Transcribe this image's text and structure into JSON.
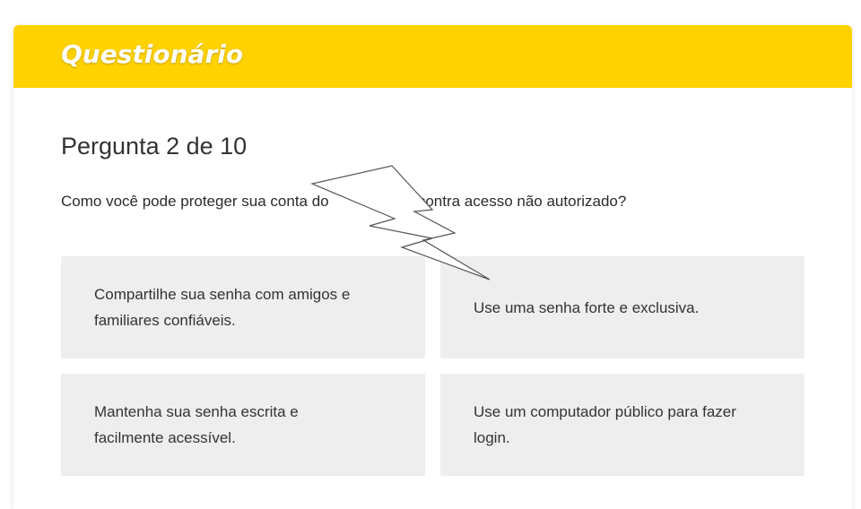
{
  "header": {
    "title": "Questionário",
    "background_color": "#ffd200"
  },
  "question": {
    "counter": "Pergunta 2 de 10",
    "text": "Como você pode proteger sua conta do                  e contra acesso não autorizado?"
  },
  "options": [
    {
      "label": "Compartilhe sua senha com amigos e familiares confiáveis."
    },
    {
      "label": "Use uma senha forte e exclusiva."
    },
    {
      "label": "Mantenha sua senha escrita e facilmente acessível."
    },
    {
      "label": "Use um computador público para fazer login."
    }
  ],
  "overlay": {
    "icon": "lightning-bolt-icon"
  }
}
